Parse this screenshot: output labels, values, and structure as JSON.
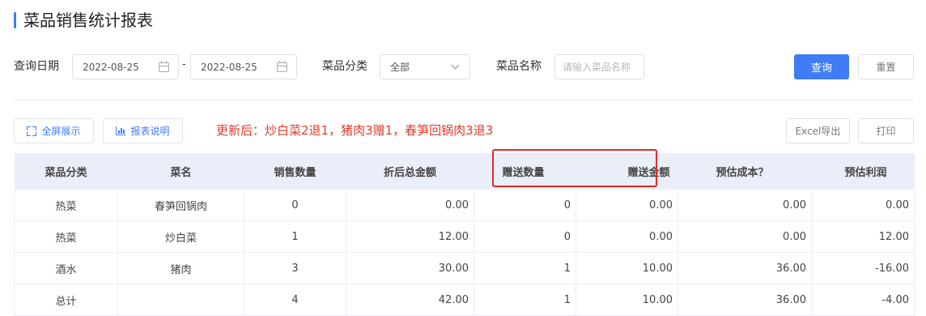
{
  "page": {
    "title": "菜品销售统计报表"
  },
  "filters": {
    "date_label": "查询日期",
    "date_start": "2022-08-25",
    "date_separator": "-",
    "date_end": "2022-08-25",
    "category_label": "菜品分类",
    "category_value": "全部",
    "name_label": "菜品名称",
    "name_placeholder": "请输入菜品名称"
  },
  "actions": {
    "search_label": "查询",
    "reset_label": "重置",
    "fullscreen_label": "全屏展示",
    "report_help_label": "报表说明",
    "excel_export_label": "Excel导出",
    "print_label": "打印"
  },
  "notice": "更新后：炒白菜2退1，猪肉3赠1，春笋回锅肉3退3",
  "table": {
    "headers": [
      "菜品分类",
      "菜名",
      "销售数量",
      "折后总金额",
      "赠送数量",
      "赠送金额",
      "预估成本？",
      "预估利润"
    ],
    "rows": [
      [
        "热菜",
        "春笋回锅肉",
        "0",
        "0.00",
        "0",
        "0.00",
        "0.00",
        "0.00"
      ],
      [
        "热菜",
        "炒白菜",
        "1",
        "12.00",
        "0",
        "0.00",
        "0.00",
        "12.00"
      ],
      [
        "酒水",
        "猪肉",
        "3",
        "30.00",
        "1",
        "10.00",
        "36.00",
        "-16.00"
      ],
      [
        "总计",
        "",
        "4",
        "42.00",
        "1",
        "10.00",
        "36.00",
        "-4.00"
      ]
    ]
  },
  "colors": {
    "primary": "#3f7cf5",
    "notice": "#e23b2a",
    "highlight_box": "#e02a2a",
    "table_header_bg": "#e9eef8"
  }
}
